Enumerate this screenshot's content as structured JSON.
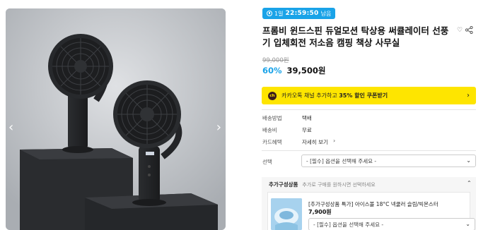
{
  "gallery": {
    "prev_icon": "chevron-left",
    "next_icon": "chevron-right"
  },
  "timer": {
    "day": "1일",
    "time": "22:59:50",
    "suffix": "남음"
  },
  "product": {
    "title": "프롬비 윈드스핀 듀얼모션 탁상용 써큘레이터 선풍기 입체회전 저소음 캠핑 책상 사무실",
    "original_price": "99,000원",
    "discount": "60%",
    "price": "39,500원"
  },
  "kakao": {
    "icon_text": "ch",
    "text_prefix": "카카오톡 채널 추가하고",
    "text_highlight": "35% 할인 쿠폰받기"
  },
  "info": [
    {
      "label": "배송방법",
      "value": "택배"
    },
    {
      "label": "배송비",
      "value": "무료"
    },
    {
      "label": "카드혜택",
      "value": "자세히 보기"
    }
  ],
  "option": {
    "label": "선택",
    "placeholder": "- [필수] 옵션을 선택해 주세요 -"
  },
  "addon": {
    "title": "추가구성상품",
    "note": "추가로 구매를 원하시면 선택하세요",
    "item_name": "[추가구성상품 특가] 아이스볼 18°C 넥쿨러 슬림/빅몬스터",
    "item_price": "7,900원",
    "item_placeholder": "- [필수] 옵션을 선택해 주세요 -"
  },
  "colors": {
    "accent": "#1aa3e8",
    "kakao": "#fee500"
  }
}
